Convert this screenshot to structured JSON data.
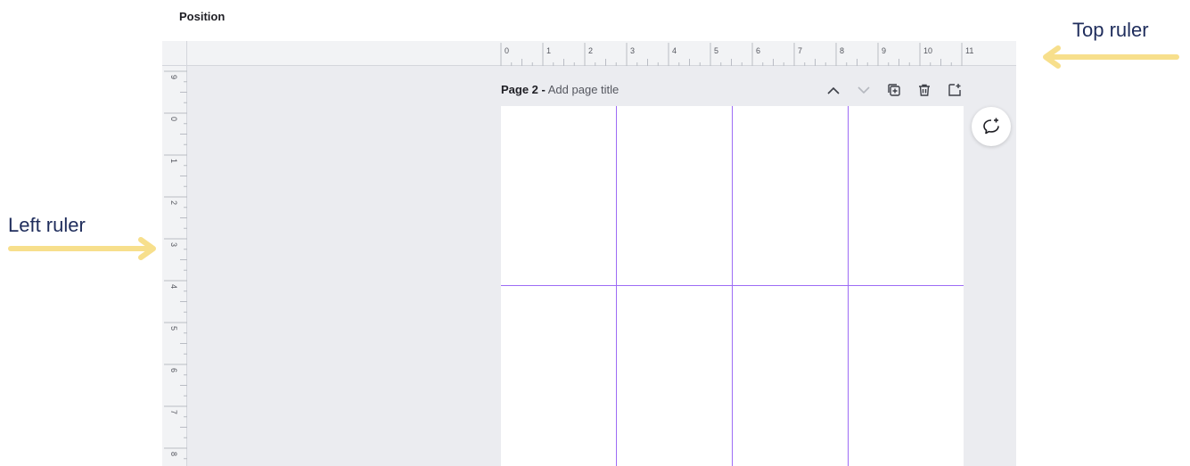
{
  "toolbar": {
    "label": "Position"
  },
  "rulers": {
    "top_ticks": [
      "0",
      "1",
      "2",
      "3",
      "4",
      "5",
      "6",
      "7",
      "8",
      "9",
      "10",
      "11"
    ],
    "left_ticks": [
      "9",
      "0",
      "1",
      "2",
      "3",
      "4",
      "5",
      "6",
      "7",
      "8"
    ]
  },
  "page": {
    "number_label": "Page 2 -",
    "title_placeholder": "Add page title"
  },
  "header_icons": [
    "chevron-up-icon",
    "chevron-down-icon",
    "duplicate-page-icon",
    "trash-icon",
    "add-page-icon"
  ],
  "annotations": {
    "top_ruler": "Top ruler",
    "left_ruler": "Left ruler"
  },
  "colors": {
    "guide": "#9d6cf5",
    "arrow": "#f7df8c",
    "annotation_text": "#1f2d5c",
    "canvas_bg": "#ebecf0"
  }
}
